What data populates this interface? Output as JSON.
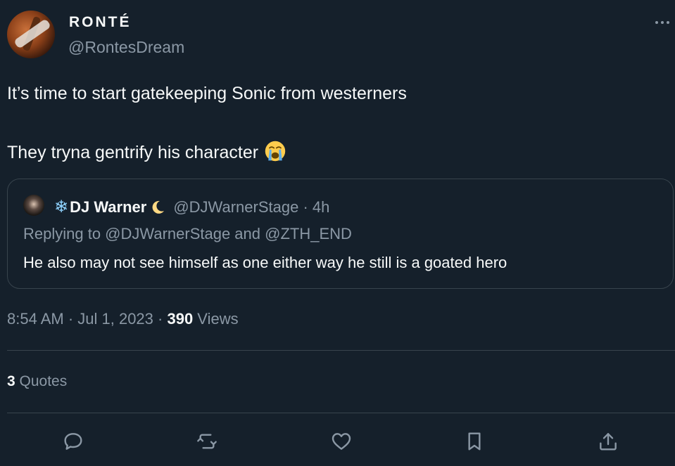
{
  "author": {
    "display_name": "RONTÉ",
    "handle": "@RontesDream"
  },
  "tweet": {
    "line1": "It’s time to start gatekeeping Sonic from westerners",
    "line2": "They tryna gentrify his character",
    "emoji": "loudly-crying-face-icon"
  },
  "quoted": {
    "name_prefix": "❄",
    "name": "DJ Warner",
    "name_suffix_icon": "crescent-moon-icon",
    "handle_time": "@DJWarnerStage · 4h",
    "replying": "Replying to @DJWarnerStage and @ZTH_END",
    "text": "He also may not see himself as one either way he still is a goated hero"
  },
  "meta": {
    "time_date": "8:54 AM · Jul 1, 2023 · ",
    "views_count": "390",
    "views_label": " Views"
  },
  "stats": {
    "quotes_count": "3",
    "quotes_label": " Quotes"
  },
  "actions": [
    "reply-icon",
    "retweet-icon",
    "like-icon",
    "bookmark-icon",
    "share-icon"
  ],
  "colors": {
    "background": "#15202b",
    "text": "#f7f9f9",
    "secondary_text": "#8b98a5",
    "border": "#38444d"
  }
}
